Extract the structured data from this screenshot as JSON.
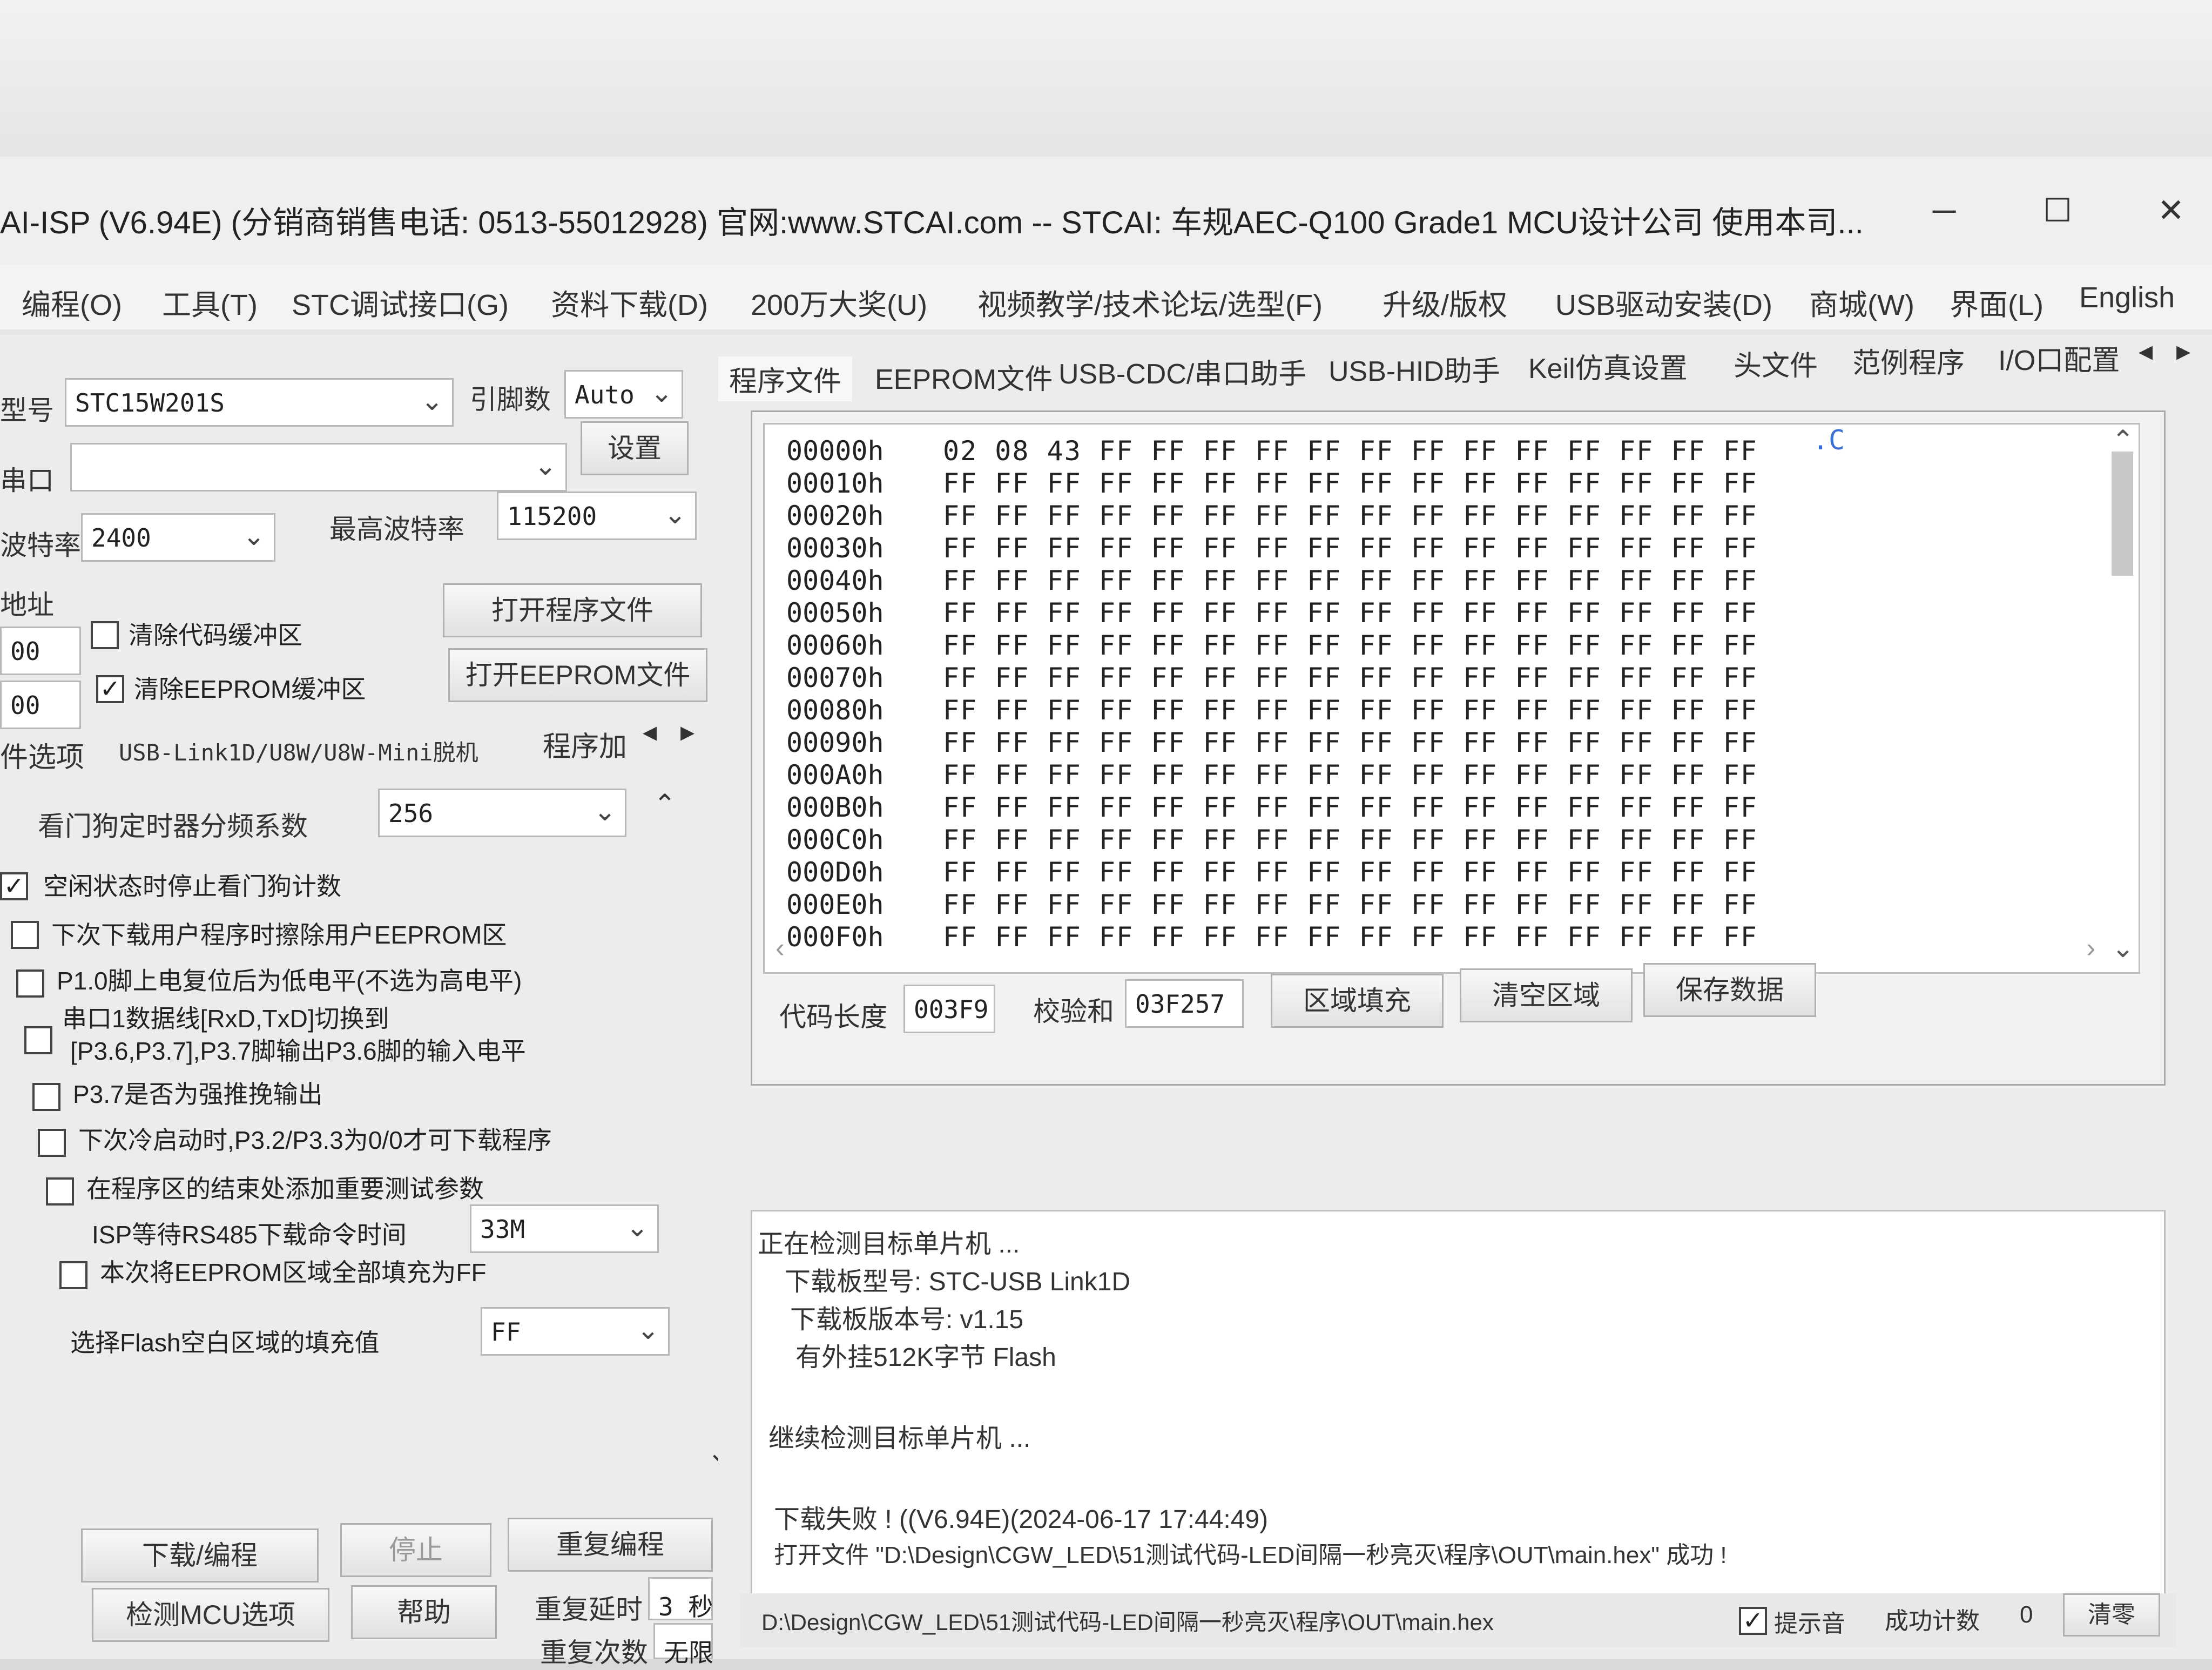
{
  "window": {
    "title": "AI-ISP (V6.94E) (分销商销售电话: 0513-55012928) 官网:www.STCAI.com  -- STCAI: 车规AEC-Q100 Grade1 MCU设计公司 使用本司...",
    "minimize_icon": "─",
    "maximize_icon": "☐",
    "close_icon": "✕"
  },
  "menu": [
    "编程(O)",
    "工具(T)",
    "STC调试接口(G)",
    "资料下载(D)",
    "200万大奖(U)",
    "视频教学/技术论坛/选型(F)",
    "升级/版权",
    "USB驱动安装(D)",
    "商城(W)",
    "界面(L)",
    "English"
  ],
  "left_panel": {
    "model_label": "型号",
    "model_value": "STC15W201S",
    "pins_label": "引脚数",
    "pins_value": "Auto",
    "port_label": "串口",
    "port_value": "",
    "settings_button": "设置",
    "baud_label": "波特率",
    "baud_value": "2400",
    "max_baud_label": "最高波特率",
    "max_baud_value": "115200",
    "address_label": "地址",
    "addr1_value": "00",
    "addr2_value": "00",
    "clear_code_buffer": "清除代码缓冲区",
    "clear_eeprom_buffer": "清除EEPROM缓冲区",
    "open_program_button": "打开程序文件",
    "open_eeprom_button": "打开EEPROM文件",
    "tabs": [
      "件选项",
      "USB-Link1D/U8W/U8W-Mini脱机",
      "程序加"
    ],
    "watchdog_label": "看门狗定时器分频系数",
    "watchdog_value": "256",
    "options": [
      {
        "label": "空闲状态时停止看门狗计数",
        "checked": true
      },
      {
        "label": "下次下载用户程序时擦除用户EEPROM区",
        "checked": false
      },
      {
        "label": "P1.0脚上电复位后为低电平(不选为高电平)",
        "checked": false
      },
      {
        "label": "串口1数据线[RxD,TxD]切换到",
        "checked": false
      },
      {
        "label": "[P3.6,P3.7],P3.7脚输出P3.6脚的输入电平",
        "checked": false
      },
      {
        "label": "P3.7是否为强推挽输出",
        "checked": false
      },
      {
        "label": "下次冷启动时,P3.2/P3.3为0/0才可下载程序",
        "checked": false
      },
      {
        "label": "在程序区的结束处添加重要测试参数",
        "checked": false
      }
    ],
    "isp_wait_label": "ISP等待RS485下载命令时间",
    "isp_wait_value": "33M",
    "fill_ff_label": "本次将EEPROM区域全部填充为FF",
    "fill_flash_label": "选择Flash空白区域的填充值",
    "fill_flash_value": "FF",
    "download_button": "下载/编程",
    "stop_button": "停止",
    "reprogram_button": "重复编程",
    "detect_button": "检测MCU选项",
    "help_button": "帮助",
    "delay_label": "重复延时",
    "delay_value": "3 秒",
    "count_label": "重复次数",
    "count_value": "无限"
  },
  "right_panel": {
    "tabs": [
      "程序文件",
      "EEPROM文件",
      "USB-CDC/串口助手",
      "USB-HID助手",
      "Keil仿真设置",
      "头文件",
      "范例程序",
      "I/O口配置"
    ],
    "ascii_preview": ".C",
    "hex_rows": [
      {
        "addr": "00000h",
        "bytes": "02 08 43 FF FF FF FF FF FF FF FF FF FF FF FF FF"
      },
      {
        "addr": "00010h",
        "bytes": "FF FF FF FF FF FF FF FF FF FF FF FF FF FF FF FF"
      },
      {
        "addr": "00020h",
        "bytes": "FF FF FF FF FF FF FF FF FF FF FF FF FF FF FF FF"
      },
      {
        "addr": "00030h",
        "bytes": "FF FF FF FF FF FF FF FF FF FF FF FF FF FF FF FF"
      },
      {
        "addr": "00040h",
        "bytes": "FF FF FF FF FF FF FF FF FF FF FF FF FF FF FF FF"
      },
      {
        "addr": "00050h",
        "bytes": "FF FF FF FF FF FF FF FF FF FF FF FF FF FF FF FF"
      },
      {
        "addr": "00060h",
        "bytes": "FF FF FF FF FF FF FF FF FF FF FF FF FF FF FF FF"
      },
      {
        "addr": "00070h",
        "bytes": "FF FF FF FF FF FF FF FF FF FF FF FF FF FF FF FF"
      },
      {
        "addr": "00080h",
        "bytes": "FF FF FF FF FF FF FF FF FF FF FF FF FF FF FF FF"
      },
      {
        "addr": "00090h",
        "bytes": "FF FF FF FF FF FF FF FF FF FF FF FF FF FF FF FF"
      },
      {
        "addr": "000A0h",
        "bytes": "FF FF FF FF FF FF FF FF FF FF FF FF FF FF FF FF"
      },
      {
        "addr": "000B0h",
        "bytes": "FF FF FF FF FF FF FF FF FF FF FF FF FF FF FF FF"
      },
      {
        "addr": "000C0h",
        "bytes": "FF FF FF FF FF FF FF FF FF FF FF FF FF FF FF FF"
      },
      {
        "addr": "000D0h",
        "bytes": "FF FF FF FF FF FF FF FF FF FF FF FF FF FF FF FF"
      },
      {
        "addr": "000E0h",
        "bytes": "FF FF FF FF FF FF FF FF FF FF FF FF FF FF FF FF"
      },
      {
        "addr": "000F0h",
        "bytes": "FF FF FF FF FF FF FF FF FF FF FF FF FF FF FF FF"
      }
    ],
    "code_length_label": "代码长度",
    "code_length_value": "003F9",
    "checksum_label": "校验和",
    "checksum_value": "03F257",
    "fill_region_button": "区域填充",
    "clear_region_button": "清空区域",
    "save_data_button": "保存数据",
    "log_lines": [
      "正在检测目标单片机 ...",
      "  下载板型号: STC-USB Link1D",
      "  下载板版本号: v1.15",
      "  有外挂512K字节 Flash",
      "",
      "继续检测目标单片机 ...",
      "",
      "下载失败 ! ((V6.94E)(2024-06-17 17:44:49)",
      "打开文件 \"D:\\Design\\CGW_LED\\51测试代码-LED间隔一秒亮灭\\程序\\OUT\\main.hex\" 成功 !"
    ],
    "status_path": "D:\\Design\\CGW_LED\\51测试代码-LED间隔一秒亮灭\\程序\\OUT\\main.hex",
    "prompt_sound_label": "提示音",
    "success_count_label": "成功计数",
    "success_count_value": "0",
    "clear_button": "清零"
  }
}
